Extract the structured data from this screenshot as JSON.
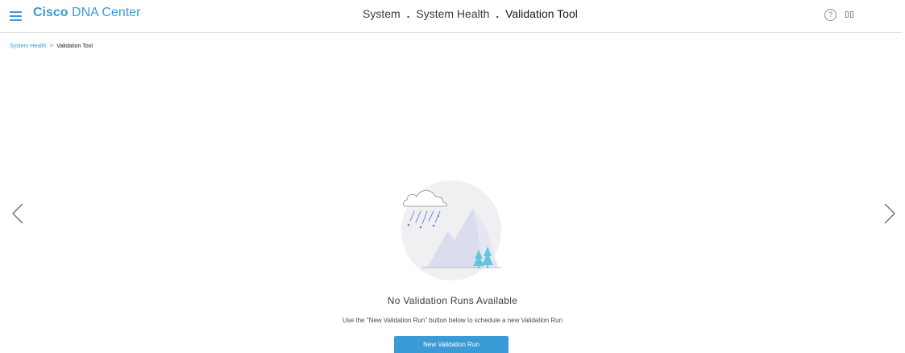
{
  "header": {
    "brand_bold": "Cisco",
    "brand_rest": " DNA Center",
    "heading": {
      "part1": "System",
      "separator": ".",
      "part2": "System Health",
      "current": "Validation Tool"
    },
    "help_glyph": "?",
    "icons": [
      "menu-icon",
      "help-icon",
      "panel-toggle-icon"
    ]
  },
  "breadcrumb": {
    "items": [
      "System Health",
      "Validation Tool"
    ],
    "separator": ">"
  },
  "empty_state": {
    "title": "No Validation Runs Available",
    "description": "Use the \"New Validation Run\" button below to schedule a new Validation Run",
    "button_label": "New Validation Run",
    "illustration": "cloud-rain-mountains-illustration"
  },
  "carousel": {
    "prev_icon": "chevron-left-icon",
    "next_icon": "chevron-right-icon"
  },
  "colors": {
    "accent": "#3a9bd6",
    "illustration_circle": "#f0f0f2",
    "mountain": "#dcdcef",
    "rain": "#5b7fd6",
    "trees": "#5fc7d9"
  }
}
